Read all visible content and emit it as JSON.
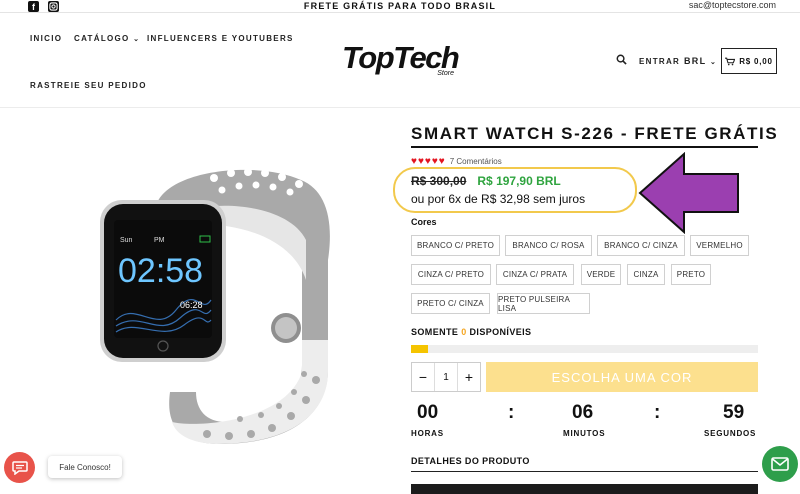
{
  "topbar": {
    "social_icons": [
      "facebook-icon",
      "instagram-icon"
    ],
    "announcement": "FRETE GRÁTIS PARA TODO BRASIL",
    "email": "sac@toptecstore.com"
  },
  "nav": {
    "inicio": "INICIO",
    "catalogo": "CATÁLOGO",
    "influencers": "INFLUENCERS E YOUTUBERS",
    "rastreie": "RASTREIE SEU PEDIDO"
  },
  "logo": {
    "word": "TopTech",
    "sub": "Store"
  },
  "header_right": {
    "search_icon": "search-icon",
    "login": "ENTRAR",
    "currency": "BRL",
    "cart": "R$ 0,00"
  },
  "product": {
    "title": "SMART WATCH S-226 - FRETE GRÁTIS",
    "rating_stars": 5,
    "reviews": "7 Comentários",
    "price_old": "R$ 300,00",
    "price_new": "R$ 197,90 BRL",
    "installments": "ou por 6x de R$ 32,98 sem juros",
    "watch_time": "02:58",
    "watch_date": "06:28",
    "watch_status": "Sun",
    "watch_pm": "PM"
  },
  "options": {
    "label": "Cores",
    "colors": [
      "BRANCO C/ PRETO",
      "BRANCO C/ ROSA",
      "BRANCO C/ CINZA",
      "VERMELHO",
      "CINZA C/ PRETO",
      "CINZA C/ PRATA",
      "VERDE",
      "CINZA",
      "PRETO",
      "PRETO C/ CINZA",
      "PRETO PULSEIRA LISA"
    ]
  },
  "stock": {
    "prefix": "SOMENTE",
    "count": "0",
    "suffix": "DISPONÍVEIS",
    "fill_fraction": 0.05
  },
  "purchase": {
    "minus": "−",
    "quantity": "1",
    "plus": "+",
    "button": "ESCOLHA UMA COR"
  },
  "countdown": {
    "hours": "00",
    "minutes": "06",
    "seconds": "59",
    "sep": ":",
    "hours_label": "HORAS",
    "minutes_label": "MINUTOS",
    "seconds_label": "SEGUNDOS"
  },
  "details": {
    "heading": "DETALHES DO PRODUTO"
  },
  "widgets": {
    "chat_label": "Fale Conosco!",
    "chat_icon": "chat-bubble-icon",
    "mail_icon": "mail-icon"
  },
  "colors": {
    "price_new": "#2fa43f",
    "highlight": "#f2c94c",
    "arrow": "#9b3fb0",
    "stars": "#e3141f",
    "buy_button": "#fce08e",
    "chat": "#e8534a",
    "mail": "#2e9e4b"
  }
}
